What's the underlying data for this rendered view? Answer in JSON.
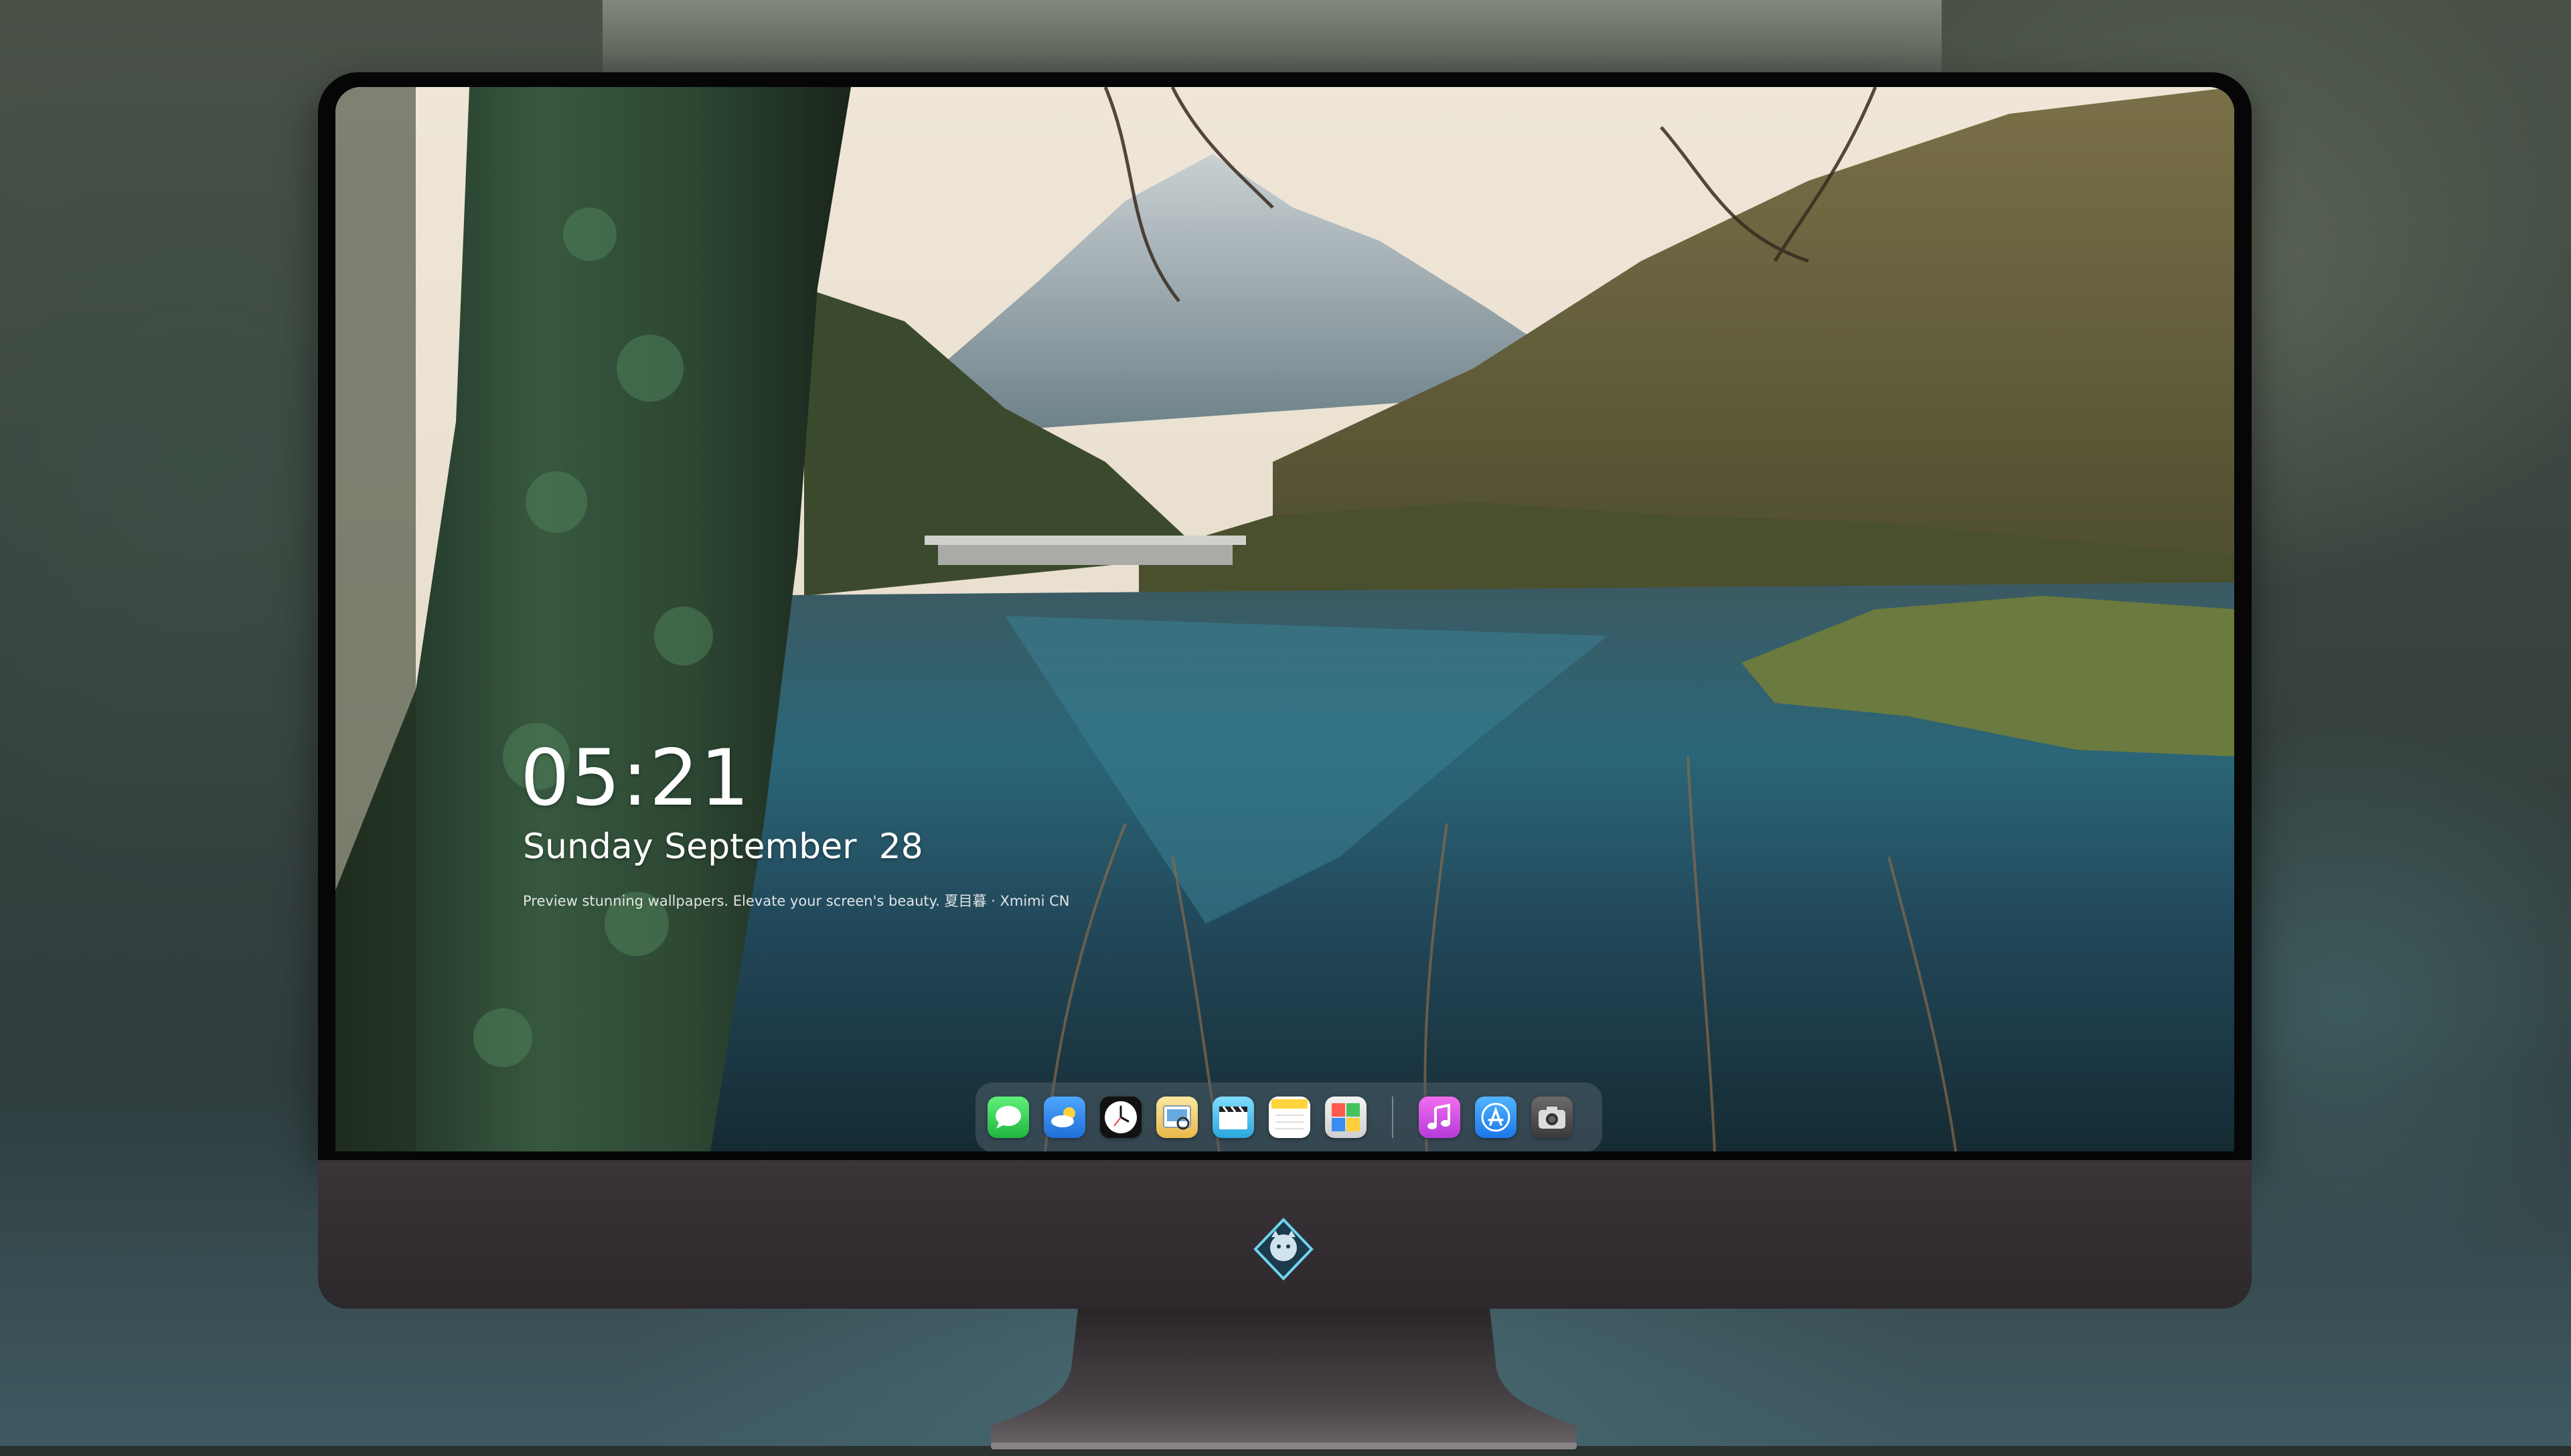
{
  "lockscreen": {
    "time": "05:21",
    "date": "Sunday September  28",
    "caption": "Preview stunning wallpapers. Elevate your screen's beauty. 夏目暮 · Xmimi CN"
  },
  "dock": {
    "apps": [
      {
        "icon": "messages-icon",
        "color": "#2fcd4f"
      },
      {
        "icon": "weather-icon",
        "color": "#3a8ff0"
      },
      {
        "icon": "clock-icon",
        "color": "#ffffff"
      },
      {
        "icon": "preview-icon",
        "color": "#f2c53d"
      },
      {
        "icon": "final-cut-icon",
        "color": "#5ec8f2"
      },
      {
        "icon": "notes-icon",
        "color": "#ffd84a"
      },
      {
        "icon": "photo-booth-icon",
        "color": "#e8e8e8"
      },
      {
        "icon": "music-icon",
        "color": "#e04dd6"
      },
      {
        "icon": "app-store-icon",
        "color": "#2b8ef5"
      },
      {
        "icon": "camera-icon",
        "color": "#4a4a4a"
      }
    ]
  }
}
